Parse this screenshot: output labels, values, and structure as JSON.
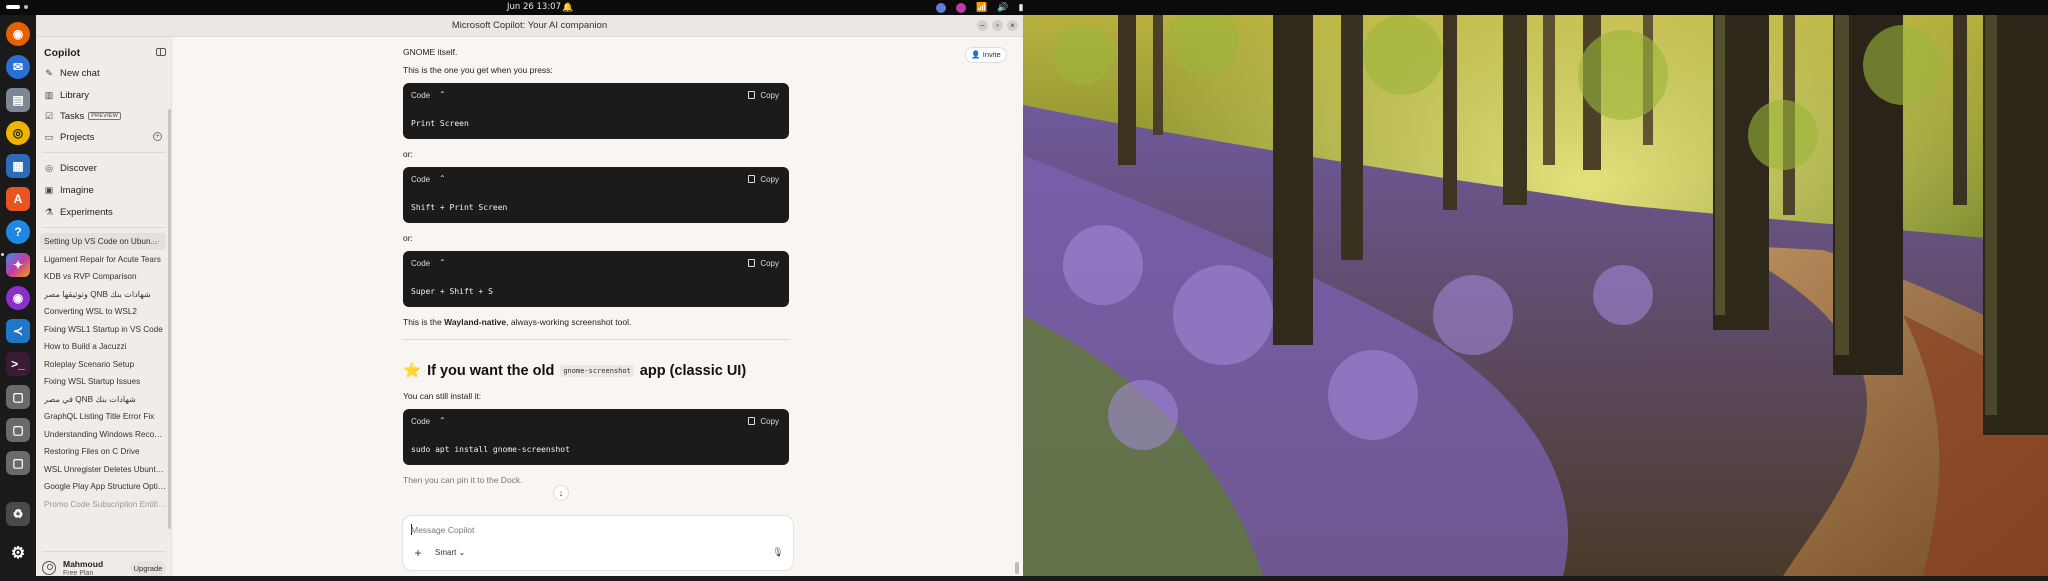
{
  "topbar": {
    "clock": "Jun 26  13:07"
  },
  "window": {
    "title": "Microsoft Copilot: Your AI companion"
  },
  "sidebar": {
    "title": "Copilot",
    "nav": [
      {
        "label": "New chat",
        "icon": "new-chat-icon"
      },
      {
        "label": "Library",
        "icon": "library-icon"
      },
      {
        "label": "Tasks",
        "icon": "tasks-icon",
        "badge": "PREVIEW"
      },
      {
        "label": "Projects",
        "icon": "folder-icon"
      }
    ],
    "discover": [
      {
        "label": "Discover",
        "icon": "compass-icon"
      },
      {
        "label": "Imagine",
        "icon": "image-icon"
      },
      {
        "label": "Experiments",
        "icon": "experiments-icon"
      }
    ],
    "chats": [
      "Setting Up VS Code on Ubun...",
      "Ligament Repair for Acute Tears",
      "KDB vs RVP Comparison",
      "شهادات بنك QNB وتوثيقها مصر",
      "Converting WSL to WSL2",
      "Fixing WSL1 Startup in VS Code",
      "How to Build a Jacuzzi",
      "Roleplay Scenario Setup",
      "Fixing WSL Startup Issues",
      "شهادات بنك QNB في مصر",
      "GraphQL Listing Title Error Fix",
      "Understanding Windows Recover...",
      "Restoring Files on C Drive",
      "WSL Unregister Deletes Ubuntu ...",
      "Google Play App Structure Options",
      "Promo Code Subscription Entitle..."
    ],
    "user": {
      "name": "Mahmoud",
      "plan": "Free Plan",
      "upgrade_label": "Upgrade"
    }
  },
  "main": {
    "invite_label": "Invite",
    "intro_text": "GNOME itself.",
    "press_text": "This is the one you get when you press:",
    "code_label": "Code",
    "copy_label": "Copy",
    "codes": [
      "Print Screen",
      "Shift + Print Screen",
      "Super + Shift + S"
    ],
    "or_text": "or:",
    "wayland_prefix": "This is the ",
    "wayland_bold": "Wayland-native",
    "wayland_suffix": ", always-working screenshot tool.",
    "heading_emoji": "⭐",
    "heading_pre": "If you want the old",
    "heading_code": "gnome-screenshot",
    "heading_post": "app (classic UI)",
    "install_text": "You can still install it:",
    "install_code": "sudo apt install gnome-screenshot",
    "pin_text": "Then you can pin it to the Dock.",
    "composer": {
      "placeholder": "Message Copilot",
      "mode": "Smart"
    }
  },
  "dock": {
    "apps": [
      "firefox-icon",
      "thunderbird-icon",
      "files-icon",
      "rhythmbox-icon",
      "libreoffice-writer-icon",
      "app-center-icon",
      "help-icon",
      "copilot-icon",
      "firefox-dev-icon",
      "vscode-icon",
      "terminal-icon",
      "generic-app-icon",
      "generic-app-icon-2",
      "generic-app-icon-3",
      "trash-icon",
      "show-apps-icon"
    ]
  }
}
